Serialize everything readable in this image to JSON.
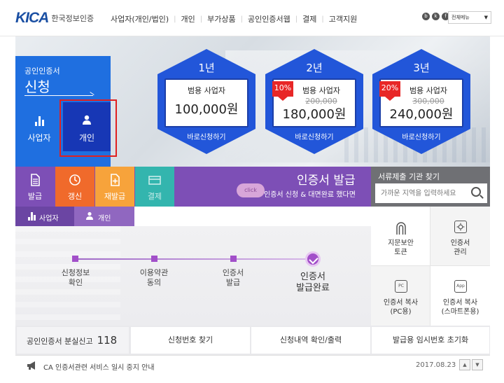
{
  "header": {
    "logo_mark": "KICA",
    "logo_text": "한국정보인증",
    "nav": [
      "사업자(개인/법인)",
      "개인",
      "부가상품",
      "공인인증서웹",
      "결제",
      "고객지원"
    ],
    "all_menu_label": "전체메뉴"
  },
  "apply": {
    "subtitle": "공인인증서",
    "title": "신청",
    "tab_business": "사업자",
    "tab_personal": "개인"
  },
  "prices": [
    {
      "year": "1년",
      "category": "범용 사업자",
      "old_price": "",
      "price": "100,000원",
      "discount": "",
      "button": "바로신청하기"
    },
    {
      "year": "2년",
      "category": "범용 사업자",
      "old_price": "200,000",
      "price": "180,000원",
      "discount": "10%",
      "button": "바로신청하기"
    },
    {
      "year": "3년",
      "category": "범용 사업자",
      "old_price": "300,000",
      "price": "240,000원",
      "discount": "20%",
      "button": "바로신청하기"
    }
  ],
  "menu": {
    "issue": "발급",
    "renew": "갱신",
    "reissue": "재발급",
    "pay": "결제"
  },
  "band": {
    "title": "인증서 발급",
    "subtitle": "인증서 신청 & 대면완료 했다면",
    "badge": "click"
  },
  "subtabs": {
    "business": "사업자",
    "personal": "개인"
  },
  "steps": [
    {
      "l1": "신청정보",
      "l2": "확인"
    },
    {
      "l1": "이용약관",
      "l2": "동의"
    },
    {
      "l1": "인증서",
      "l2": "발급"
    },
    {
      "l1": "인증서",
      "l2": "발급완료"
    }
  ],
  "find": {
    "title": "서류제출 기관 찾기",
    "placeholder": "가까운 지역을 입력하세요"
  },
  "quick": [
    {
      "l1": "지문보안",
      "l2": "토큰",
      "icon": "fingerprint-icon"
    },
    {
      "l1": "인증서",
      "l2": "관리",
      "icon": "gear-icon"
    },
    {
      "l1": "인증서 복사",
      "l2": "(PC용)",
      "icon": "pc-icon",
      "glyph": "PC"
    },
    {
      "l1": "인증서 복사",
      "l2": "(스마트폰용)",
      "icon": "app-icon",
      "glyph": "App"
    }
  ],
  "bottom": {
    "lost_label": "공인인증서 분실신고",
    "lost_number": "118",
    "btn1": "신청번호 찾기",
    "btn2": "신청내역 확인/출력",
    "btn3": "발급용 임시번호 초기화"
  },
  "notice": {
    "text": "CA 인증서관련 서비스 일시 중지 안내",
    "date": "2017.08.23"
  },
  "colors": {
    "primary_blue": "#1f6fe0",
    "hex_blue": "#2256d9",
    "purple": "#7d4fb6",
    "orange": "#f06a2b",
    "amber": "#f7a33b",
    "teal": "#33b5ae",
    "red_highlight": "#e02020"
  }
}
